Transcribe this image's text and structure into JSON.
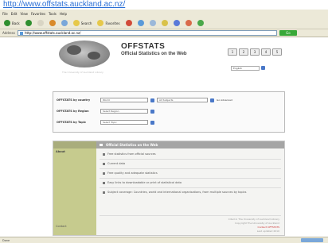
{
  "page_url": "http://www.offstats.auckland.ac.nz/",
  "menubar": {
    "items": [
      "File",
      "Edit",
      "View",
      "Favorites",
      "Tools",
      "Help"
    ]
  },
  "toolbar": {
    "buttons": [
      {
        "label": "Back",
        "color": "#2f8f2f"
      },
      {
        "label": "",
        "color": "#2f8f2f"
      },
      {
        "label": "",
        "color": "#d9d5c4"
      },
      {
        "label": "",
        "color": "#d98a2a"
      },
      {
        "label": "",
        "color": "#7aa7d9"
      },
      {
        "label": "Search",
        "color": "#e6c84a"
      },
      {
        "label": "Favorites",
        "color": "#e6c84a"
      },
      {
        "label": "",
        "color": "#d14b3a"
      },
      {
        "label": "",
        "color": "#5a9ad9"
      },
      {
        "label": "",
        "color": "#9bb8d9"
      },
      {
        "label": "",
        "color": "#d9c24a"
      },
      {
        "label": "",
        "color": "#5a7ad9"
      },
      {
        "label": "",
        "color": "#d96a4a"
      },
      {
        "label": "",
        "color": "#4aa84a"
      }
    ]
  },
  "addressbar": {
    "label": "Address",
    "url": "http://www.offstats.auckland.ac.nz/",
    "go_label": "Go"
  },
  "site": {
    "brand": "OFFSTATS",
    "tagline": "Official Statistics on the Web",
    "subline": "The University of Auckland Library",
    "nav_buttons": [
      "1",
      "2",
      "3",
      "4",
      "5"
    ],
    "language": "English"
  },
  "filters": {
    "rows": [
      {
        "label": "OFFSTATS by country",
        "value": "World",
        "value2": "All Subjects",
        "hint": "Go Advanced"
      },
      {
        "label": "OFFSTATS by Region",
        "value": "Select Region"
      },
      {
        "label": "OFFSTATS by Topic",
        "value": "Select Topic"
      }
    ]
  },
  "content": {
    "title": "Official Statistics on the Web",
    "side_top": "About",
    "side_bottom": "Contact",
    "lines": [
      "Free statistics from official sources",
      "Current data",
      "Free quality and adequate statistics",
      "Easy links to downloadable or print of statistical data",
      "Subject coverage: Countries, world and international organisations, from multiple sources by topics"
    ],
    "footer": [
      "Cited in The University of Auckland Library",
      "Copyright The University of Auckland",
      "Contact OFFSTATS",
      "Last updated 2010"
    ]
  },
  "statusbar": {
    "text": "Done"
  }
}
